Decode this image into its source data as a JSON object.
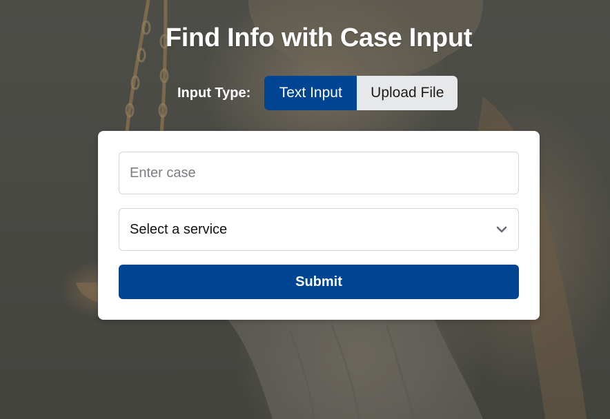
{
  "page": {
    "title": "Find Info with Case Input"
  },
  "input_type": {
    "label": "Input Type:",
    "options": [
      {
        "label": "Text Input",
        "selected": true
      },
      {
        "label": "Upload File",
        "selected": false
      }
    ]
  },
  "form": {
    "case_input": {
      "value": "",
      "placeholder": "Enter case"
    },
    "service_select": {
      "selected": "Select a service",
      "icon": "chevron-down-icon"
    },
    "submit_label": "Submit"
  },
  "colors": {
    "accent": "#004494",
    "toggle_inactive": "#e7e8ea",
    "card_background": "#ffffff"
  }
}
